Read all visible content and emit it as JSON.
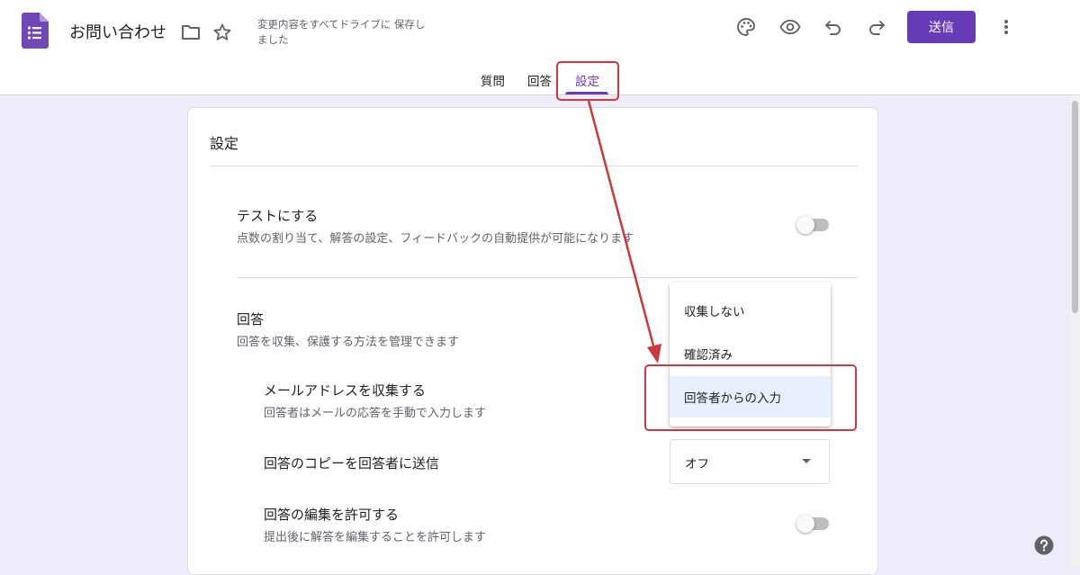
{
  "header": {
    "title": "お問い合わせ",
    "save_status": "変更内容をすべてドライブに 保存しました",
    "send_label": "送信",
    "icons": [
      "forms-logo-icon",
      "folder-icon",
      "star-icon",
      "palette-icon",
      "preview-eye-icon",
      "undo-icon",
      "redo-icon",
      "more-vert-icon"
    ]
  },
  "tabs": [
    {
      "label": "質問"
    },
    {
      "label": "回答"
    },
    {
      "label": "設定",
      "active": true
    }
  ],
  "settings": {
    "title": "設定",
    "quiz": {
      "title": "テストにする",
      "description": "点数の割り当て、解答の設定、フィードバックの自動提供が可能になります",
      "enabled": false
    },
    "responses": {
      "title": "回答",
      "description": "回答を収集、保護する方法を管理できます",
      "collect_email": {
        "title": "メールアドレスを収集する",
        "description": "回答者はメールの応答を手動で入力します",
        "options": [
          "収集しない",
          "確認済み",
          "回答者からの入力"
        ],
        "selected": "回答者からの入力"
      },
      "send_copy": {
        "title": "回答のコピーを回答者に送信",
        "value": "オフ"
      },
      "allow_edit": {
        "title": "回答の編集を許可する",
        "description": "提出後に解答を編集することを許可します",
        "enabled": false
      }
    }
  },
  "colors": {
    "accent": "#673ab7",
    "annotation": "#c9393e",
    "background": "#f0ebf8"
  }
}
